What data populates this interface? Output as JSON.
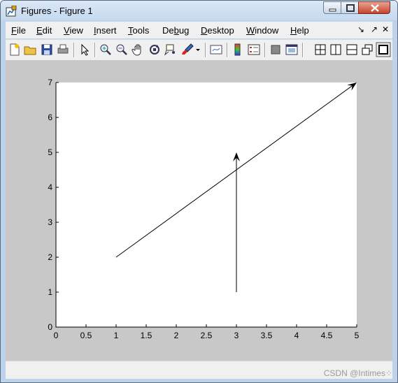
{
  "window": {
    "title": "Figures - Figure 1",
    "icon": "matlab-figure-icon",
    "controls": [
      "minimize-icon",
      "maximize-icon",
      "close-icon"
    ]
  },
  "menubar": {
    "items": [
      {
        "label": "File",
        "underline": "F"
      },
      {
        "label": "Edit",
        "underline": "E"
      },
      {
        "label": "View",
        "underline": "V"
      },
      {
        "label": "Insert",
        "underline": "I"
      },
      {
        "label": "Tools",
        "underline": "T"
      },
      {
        "label": "Debug",
        "underline": "b"
      },
      {
        "label": "Desktop",
        "underline": "D"
      },
      {
        "label": "Window",
        "underline": "W"
      },
      {
        "label": "Help",
        "underline": "H"
      }
    ],
    "right_glyphs": [
      "↘",
      "↗",
      "✕"
    ]
  },
  "toolbar": {
    "buttons": [
      "new-figure-icon",
      "open-icon",
      "save-icon",
      "print-icon",
      "edit-plot-icon",
      "zoom-in-icon",
      "zoom-out-icon",
      "pan-icon",
      "rotate-3d-icon",
      "data-cursor-icon",
      "brush-icon",
      "brush-dropdown-icon",
      "link-plot-icon",
      "colorbar-icon",
      "legend-icon",
      "hide-plot-tools-icon",
      "show-plot-tools-icon",
      "tile-icon",
      "left-right-icon",
      "top-bottom-icon",
      "float-icon",
      "maximize-figure-icon"
    ]
  },
  "chart_data": {
    "type": "line",
    "title": "",
    "xlabel": "",
    "ylabel": "",
    "xlim": [
      0,
      5
    ],
    "ylim": [
      0,
      7
    ],
    "xticks": [
      "0",
      "0.5",
      "1",
      "1.5",
      "2",
      "2.5",
      "3",
      "3.5",
      "4",
      "4.5",
      "5"
    ],
    "yticks": [
      "0",
      "1",
      "2",
      "3",
      "4",
      "5",
      "6",
      "7"
    ],
    "grid": false,
    "series": [
      {
        "style": "arrow",
        "x": [
          1,
          5
        ],
        "y": [
          2,
          7
        ],
        "color": "#000000"
      },
      {
        "style": "arrow",
        "x": [
          3,
          3
        ],
        "y": [
          1,
          5
        ],
        "color": "#000000"
      }
    ]
  },
  "watermark": "CSDN @Intimes⁘"
}
